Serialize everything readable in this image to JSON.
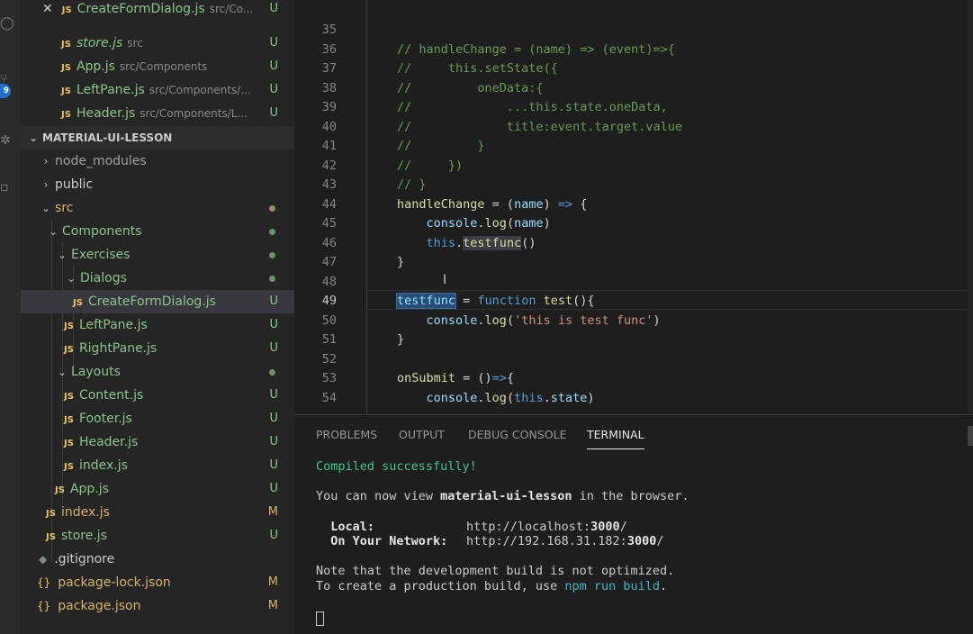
{
  "open_editors": [
    {
      "name": "CreateFormDialog.js",
      "path": "src/Co...",
      "status": "U",
      "active": true
    },
    {
      "name": "store.js",
      "path": "src",
      "status": "U",
      "italic": true
    },
    {
      "name": "App.js",
      "path": "src/Components",
      "status": "U"
    },
    {
      "name": "LeftPane.js",
      "path": "src/Components/...",
      "status": "U"
    },
    {
      "name": "Header.js",
      "path": "src/Components/L...",
      "status": "U"
    }
  ],
  "activity_badge": "9",
  "project": {
    "title": "MATERIAL-UI-LESSON"
  },
  "tree": {
    "node_modules": "node_modules",
    "public": "public",
    "src": "src",
    "components": "Components",
    "exercises": "Exercises",
    "dialogs": "Dialogs",
    "create_form_dialog": "CreateFormDialog.js",
    "left_pane": "LeftPane.js",
    "right_pane": "RightPane.js",
    "layouts": "Layouts",
    "content": "Content.js",
    "footer": "Footer.js",
    "header": "Header.js",
    "index_layouts": "index.js",
    "app": "App.js",
    "index_src": "index.js",
    "store": "store.js",
    "gitignore": ".gitignore",
    "package_lock": "package-lock.json",
    "package": "package.json"
  },
  "status": {
    "u": "U",
    "m": "M"
  },
  "js_badge": "JS",
  "json_badge": "{}",
  "code_lines": [
    {
      "n": "35"
    },
    {
      "n": "36",
      "a": "// handleChange = (name) => (event)=>{"
    },
    {
      "n": "37",
      "a": "//     this.setState({"
    },
    {
      "n": "38",
      "a": "//         oneData:{"
    },
    {
      "n": "39",
      "a": "//             ...this.state.oneData,"
    },
    {
      "n": "40",
      "a": "//             title:event.target.value"
    },
    {
      "n": "41",
      "a": "//         }"
    },
    {
      "n": "42",
      "a": "//     })"
    },
    {
      "n": "43",
      "a": "// }"
    },
    {
      "n": "44",
      "a": "handleChange",
      "b": " = (",
      "c": "name",
      "d": ") ",
      "e": "=>",
      "f": " {"
    },
    {
      "n": "45",
      "a": "    console",
      "b": ".",
      "c": "log",
      "d": "(",
      "e": "name",
      "f": ")"
    },
    {
      "n": "46",
      "a": "    this",
      "b": ".",
      "c": "testfunc",
      "d": "()"
    },
    {
      "n": "47",
      "a": "}"
    },
    {
      "n": "48"
    },
    {
      "n": "49",
      "a": "testfunc",
      "b": " = ",
      "c": "function",
      "d": " ",
      "e": "test",
      "f": "(){"
    },
    {
      "n": "50",
      "a": "    console",
      "b": ".",
      "c": "log",
      "d": "(",
      "e": "'this is test func'",
      "f": ")"
    },
    {
      "n": "51",
      "a": "}"
    },
    {
      "n": "52"
    },
    {
      "n": "53",
      "a": "onSubmit",
      "b": " = ()",
      "c": "=>",
      "d": "{"
    },
    {
      "n": "54",
      "a": "    console",
      "b": ".",
      "c": "log",
      "d": "(",
      "e": "this",
      "f": ".",
      "g": "state",
      "h": ")"
    }
  ],
  "panel": {
    "tabs": [
      "PROBLEMS",
      "OUTPUT",
      "DEBUG CONSOLE",
      "TERMINAL"
    ],
    "active_tab": "TERMINAL"
  },
  "terminal": {
    "compiled": "Compiled successfully!",
    "view_prefix": "You can now view ",
    "app_name": "material-ui-lesson",
    "view_suffix": " in the browser.",
    "local_label": "  Local:",
    "local_url_prefix": "http://localhost:",
    "local_port": "3000",
    "local_url_suffix": "/",
    "network_label": "  On Your Network:",
    "network_url_prefix": "http://192.168.31.182:",
    "network_port": "3000",
    "network_url_suffix": "/",
    "note": "Note that the development build is not optimized.",
    "prod_prefix": "To create a production build, use ",
    "prod_cmd": "npm run build",
    "prod_suffix": "."
  }
}
